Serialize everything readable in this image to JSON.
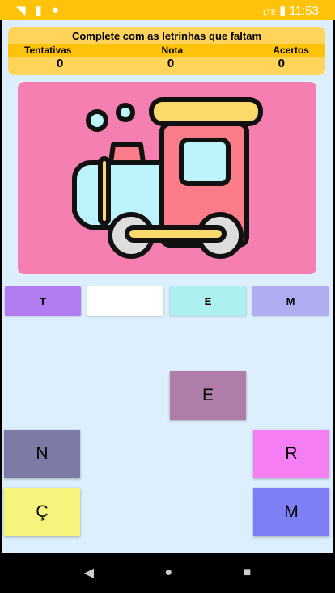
{
  "status": {
    "time": "11:53",
    "network": "LTE"
  },
  "header": {
    "title": "Complete com as letrinhas que faltam",
    "labels": [
      "Tentativas",
      "Nota",
      "Acertos"
    ],
    "values": [
      "0",
      "0",
      "0"
    ]
  },
  "slots": [
    "T",
    "",
    "E",
    "M"
  ],
  "tiles": [
    "E",
    "N",
    "R",
    "Ç",
    "M"
  ],
  "colors": {
    "accent": "#fdc30a",
    "card": "#f57fb0"
  }
}
